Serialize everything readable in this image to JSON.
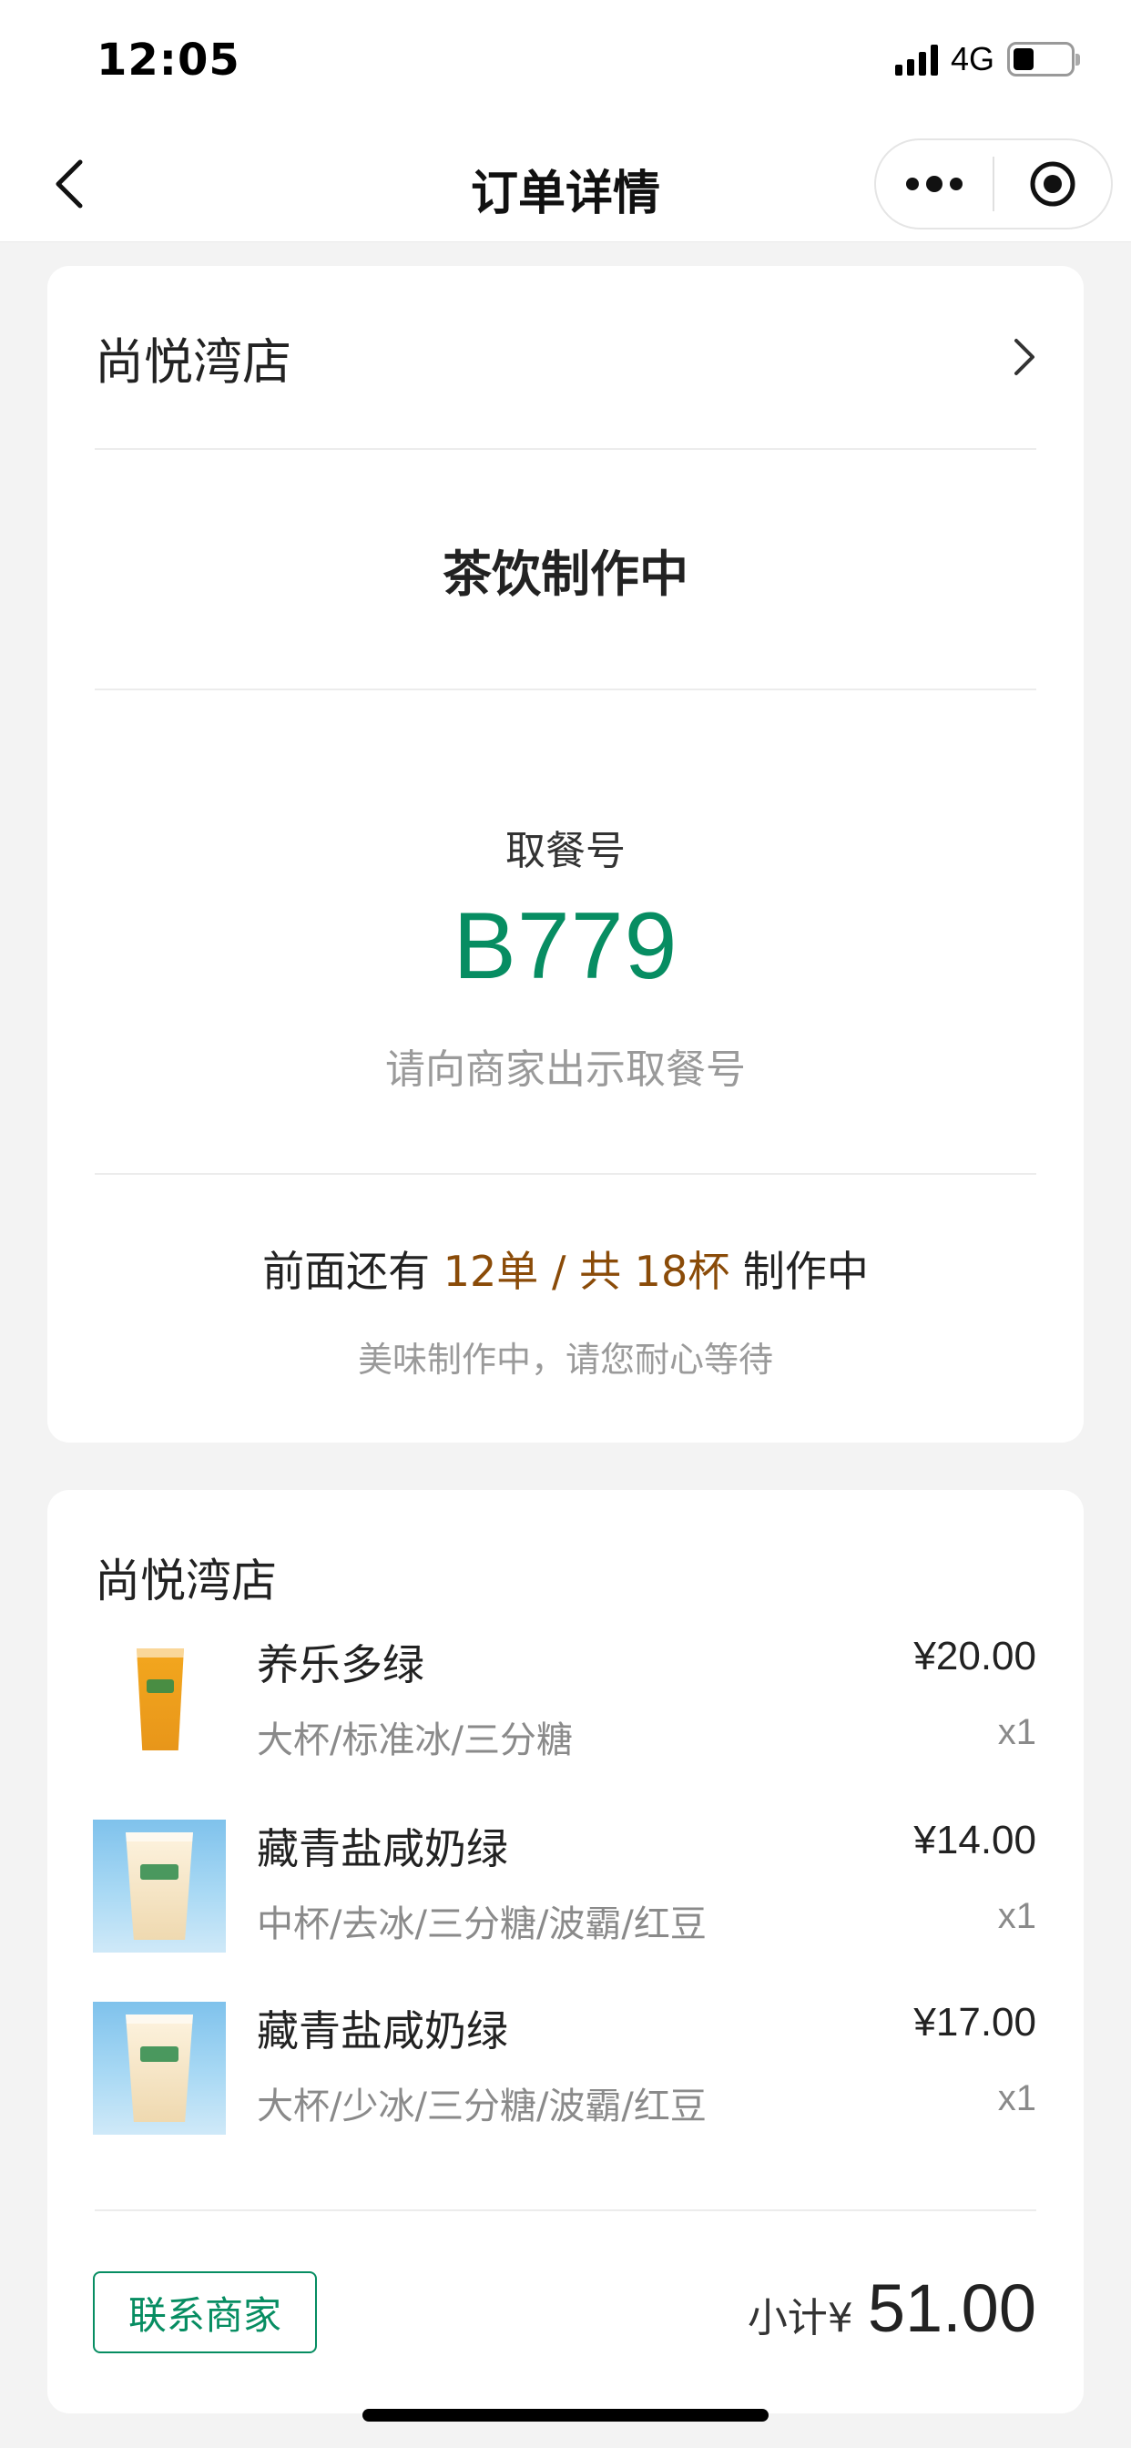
{
  "status_bar": {
    "time": "12:05",
    "network": "4G",
    "battery_level_fraction": 0.3
  },
  "nav": {
    "title": "订单详情",
    "back_icon": "chevron-left-icon",
    "more_icon": "more-dots-icon",
    "close_icon": "target-circle-icon"
  },
  "order_status_card": {
    "shop_name": "尚悦湾店",
    "status": "茶饮制作中",
    "pickup_label": "取餐号",
    "pickup_number": "B779",
    "pickup_hint": "请向商家出示取餐号",
    "queue_prefix": "前面还有",
    "queue_orders": "12单",
    "queue_separator": "/",
    "queue_cups": "共 18杯",
    "queue_suffix": "制作中",
    "queue_sub": "美味制作中，请您耐心等待"
  },
  "order_items_card": {
    "shop_name": "尚悦湾店",
    "items": [
      {
        "name": "养乐多绿",
        "spec": "大杯/标准冰/三分糖",
        "price": "¥20.00",
        "qty": "x1"
      },
      {
        "name": "藏青盐咸奶绿",
        "spec": "中杯/去冰/三分糖/波霸/红豆",
        "price": "¥14.00",
        "qty": "x1"
      },
      {
        "name": "藏青盐咸奶绿",
        "spec": "大杯/少冰/三分糖/波霸/红豆",
        "price": "¥17.00",
        "qty": "x1"
      }
    ],
    "contact_button": "联系商家",
    "subtotal_label": "小计¥",
    "subtotal_amount": "51.00"
  },
  "colors": {
    "accent_green": "#078d62",
    "queue_highlight": "#8a4b08",
    "background": "#f3f3f3"
  }
}
